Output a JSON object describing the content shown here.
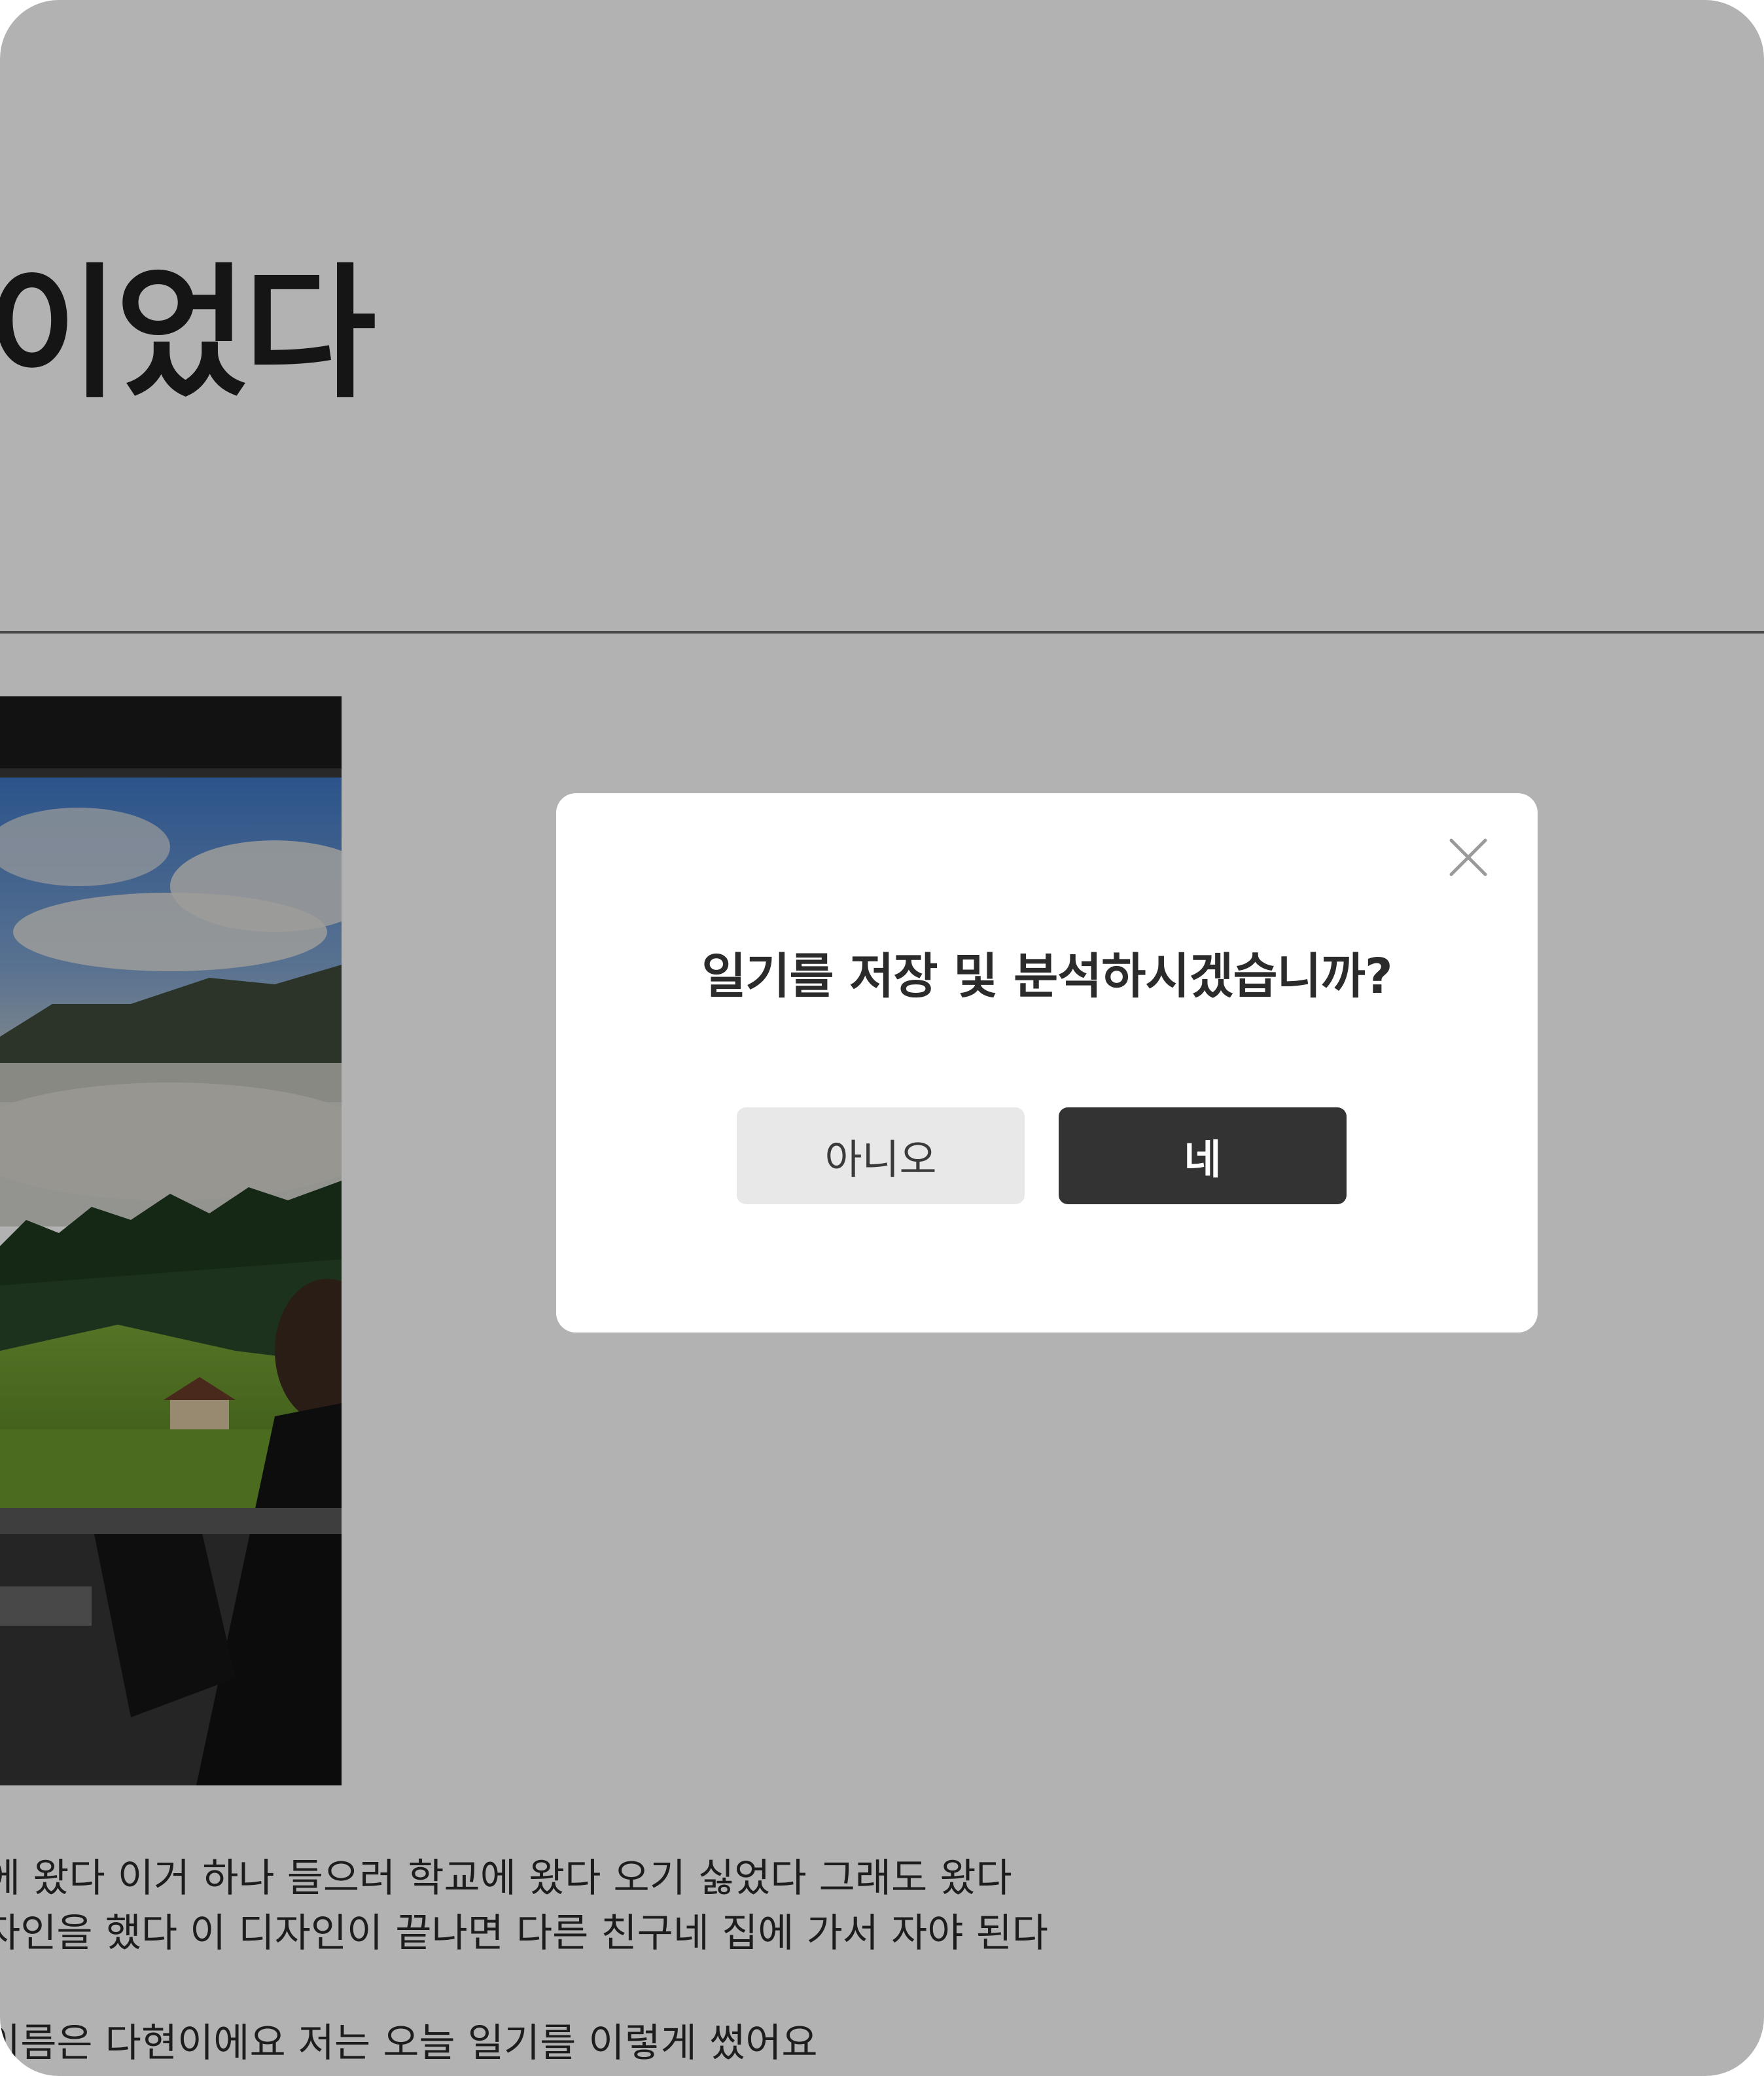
{
  "page": {
    "title_fragment": "이었다",
    "photo": {
      "description_icon": "train-window-landscape-photo"
    },
    "diary_lines": [
      "에 왔다 이거 하나 들으러 학교에 왔다 오기 싫었다 그래도 왔다",
      "자인을 했다 이 디자인이 끝나면 다른 친구네 집에 가서 자야 된다",
      "",
      "이름은 다현이에요 저는 오늘 일기를 이렇게 썼어요"
    ]
  },
  "modal": {
    "question": "일기를 저장 및 분석하시겠습니까?",
    "no_label": "아니오",
    "yes_label": "네",
    "close_icon": "close-icon"
  },
  "colors": {
    "overlay": "rgba(0,0,0,0.30)",
    "primary_button": "#333333",
    "secondary_button": "#e8e8e8"
  }
}
